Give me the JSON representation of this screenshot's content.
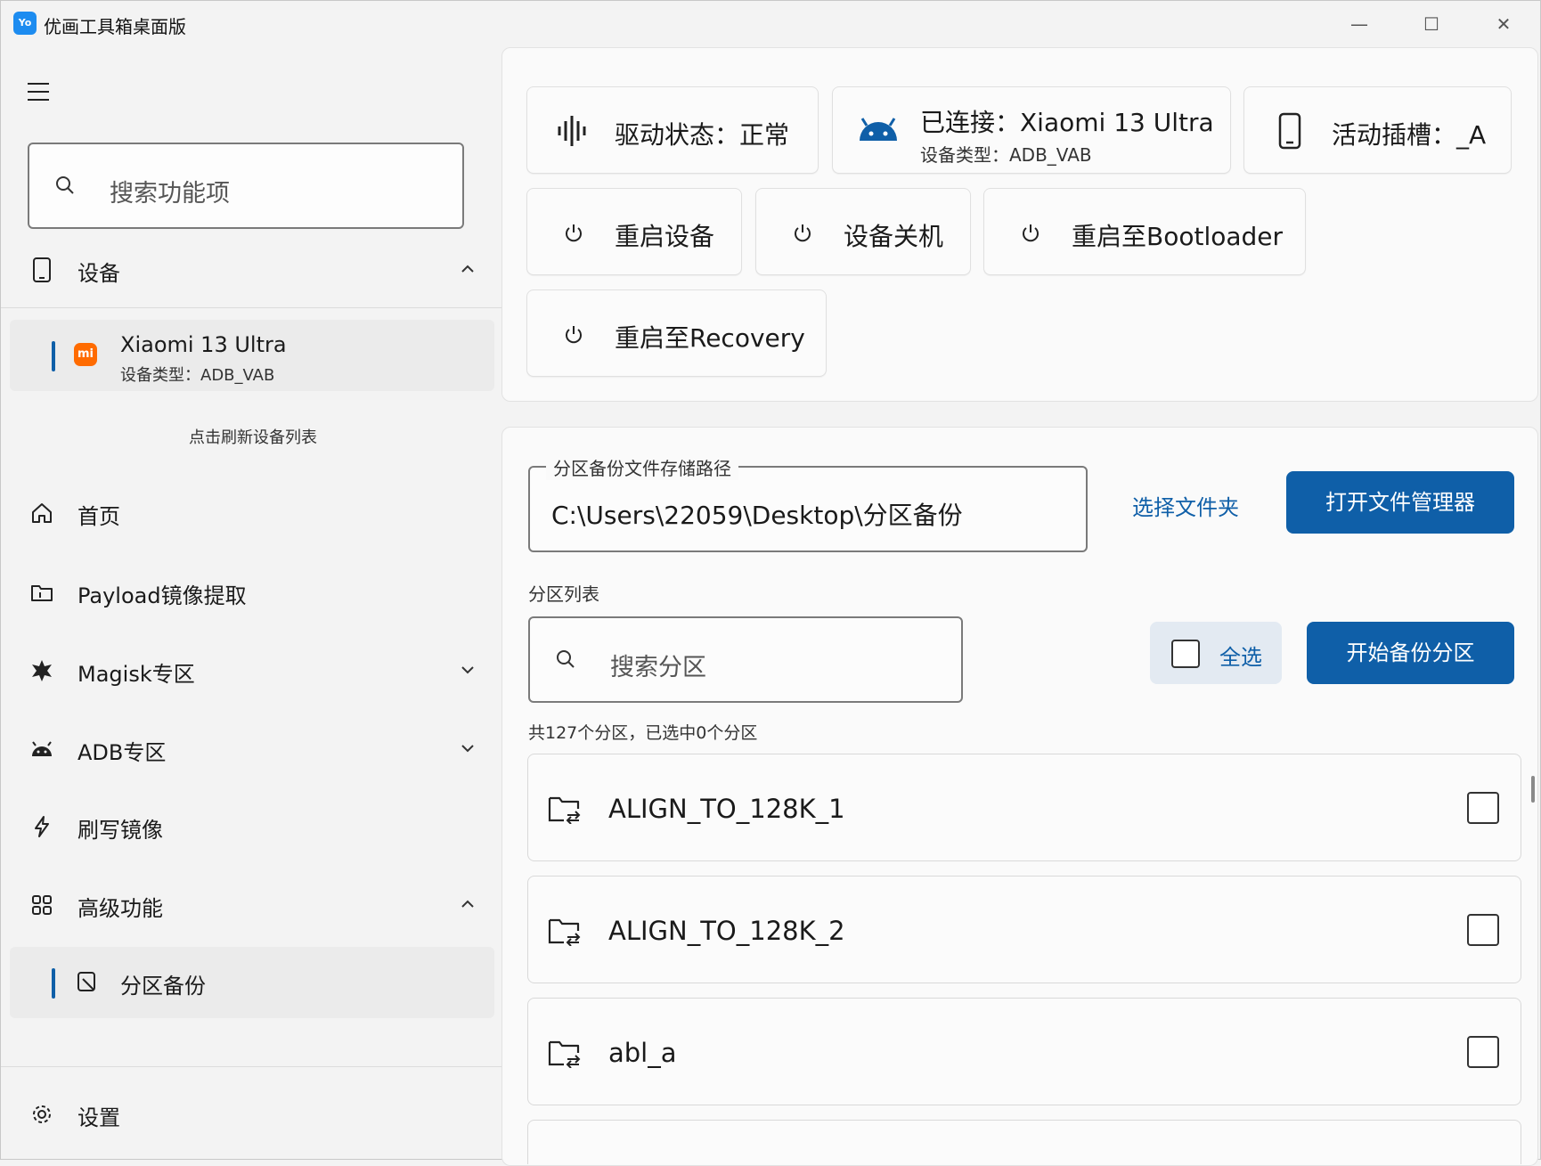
{
  "app": {
    "title": "优画工具箱桌面版",
    "logo_text": "Yo",
    "accent": "#0f5fa8"
  },
  "window_controls": {
    "minimize": "—",
    "maximize": "☐",
    "close": "✕"
  },
  "sidebar": {
    "search_placeholder": "搜索功能项",
    "device_section": "设备",
    "device": {
      "name": "Xiaomi 13 Ultra",
      "type": "设备类型：ADB_VAB",
      "logo": "mi"
    },
    "refresh_label": "点击刷新设备列表",
    "items": [
      {
        "label": "首页",
        "icon": "home-icon"
      },
      {
        "label": "Payload镜像提取",
        "icon": "folder-icon"
      },
      {
        "label": "Magisk专区",
        "icon": "magisk-icon"
      },
      {
        "label": "ADB专区",
        "icon": "android-icon"
      },
      {
        "label": "刷写镜像",
        "icon": "flash-icon"
      },
      {
        "label": "高级功能",
        "icon": "grid-icon"
      }
    ],
    "sub_item": {
      "label": "分区备份",
      "icon": "backup-icon"
    },
    "settings": "设置"
  },
  "status": {
    "driver": "驱动状态：正常",
    "connected": "已连接：Xiaomi 13 Ultra",
    "connected_sub": "设备类型：ADB_VAB",
    "slot": "活动插槽：_A"
  },
  "actions": {
    "reboot": "重启设备",
    "shutdown": "设备关机",
    "bootloader": "重启至Bootloader",
    "recovery": "重启至Recovery"
  },
  "backup": {
    "path_label": "分区备份文件存储路径",
    "path_value": "C:\\Users\\22059\\Desktop\\分区备份",
    "choose_folder": "选择文件夹",
    "open_manager": "打开文件管理器",
    "list_label": "分区列表",
    "search_placeholder": "搜索分区",
    "select_all": "全选",
    "start_backup": "开始备份分区",
    "count": "共127个分区，已选中0个分区",
    "partitions": [
      "ALIGN_TO_128K_1",
      "ALIGN_TO_128K_2",
      "abl_a"
    ]
  }
}
